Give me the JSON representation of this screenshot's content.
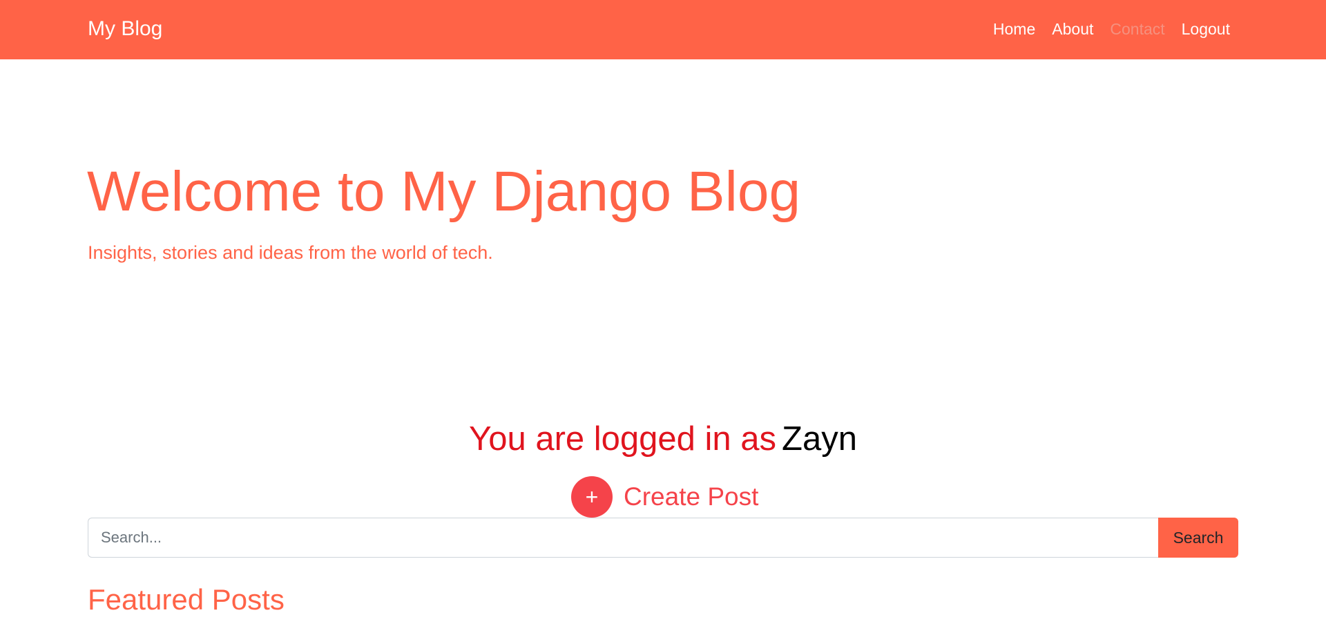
{
  "navbar": {
    "brand": "My Blog",
    "links": [
      {
        "label": "Home"
      },
      {
        "label": "About"
      },
      {
        "label": "Contact"
      },
      {
        "label": "Logout"
      }
    ]
  },
  "hero": {
    "title": "Welcome to My Django Blog",
    "subtitle": "Insights, stories and ideas from the world of tech."
  },
  "user": {
    "login_prefix": "You are logged in as",
    "username": "Zayn"
  },
  "actions": {
    "create_icon": "+",
    "create_label": "Create Post"
  },
  "search": {
    "placeholder": "Search...",
    "value": "",
    "button_label": "Search"
  },
  "sections": {
    "featured_title": "Featured Posts"
  },
  "colors": {
    "brand": "#ff6347",
    "login_prefix": "#e0141e",
    "create_accent": "#f5434a"
  }
}
